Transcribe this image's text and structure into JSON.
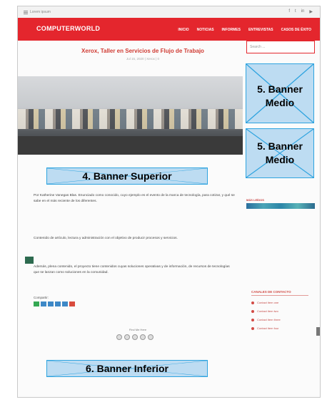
{
  "browser": {
    "brand_small": "Lorem ipsum",
    "social": [
      "f",
      "t",
      "in",
      "▶"
    ]
  },
  "site": {
    "logo": "COMPUTERWORLD",
    "nav": [
      "INICIO",
      "NOTICIAS",
      "INFORMES",
      "ENTREVISTAS",
      "CASOS DE ÉXITO"
    ],
    "search_placeholder": "Search ..."
  },
  "article": {
    "title": "Xerox, Taller en Servicios de Flujo de Trabajo",
    "meta": "Jul 15, 2020 | Xerox | 0",
    "p1": "Por Katherine Vanegas Blas. Enunciado como conocido, cuyo ejemplo es el evento de la marca de tecnología, para cotizar, y qué se sabe en el más reciente de los diferentes.",
    "p2": "Contenido de artículo, lectura y administración con el objetivo de producir procesos y servicios.",
    "p3": "Además, plena contenido, el proyecto tiene contenidos cuyas soluciones operativas y de información, de recursos de tecnologías que se lanzan como soluciones en la comunidad.",
    "share_label": "Compartir:"
  },
  "banners": {
    "superior": "4. Banner Superior",
    "medio_1": "5. Banner Medio",
    "medio_2": "5. Banner Medio",
    "inferior": "6. Banner Inferior"
  },
  "sidebar": {
    "label": "MÁS LEÍDOS",
    "contact_title": "CANALES DE CONTACTO",
    "contacts": [
      "Contact item one",
      "Contact item two",
      "Contact item three",
      "Contact item four"
    ]
  },
  "footer": {
    "text": "Find Me Here"
  }
}
